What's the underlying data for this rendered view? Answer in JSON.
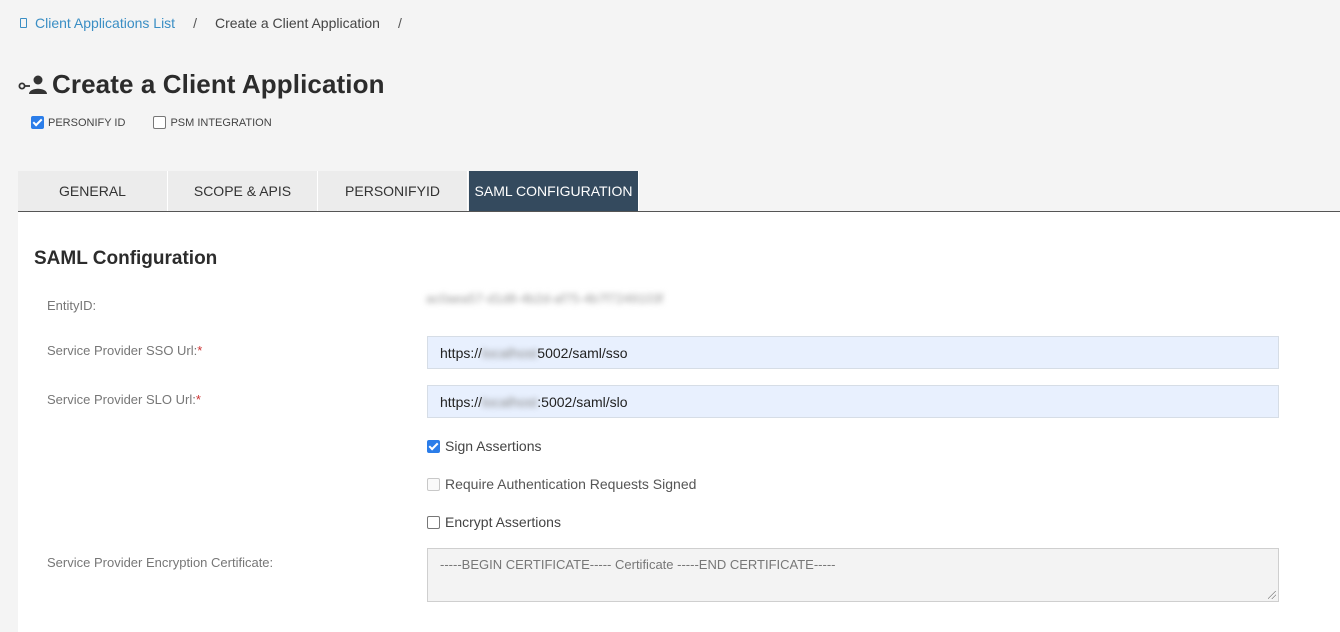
{
  "breadcrumb": {
    "items": [
      "Client Applications List",
      "Create a Client Application"
    ],
    "separator": "/"
  },
  "page": {
    "title": "Create a Client Application",
    "title_icon": "user-key-icon"
  },
  "app_types": [
    {
      "label": "PERSONIFY ID",
      "checked": true
    },
    {
      "label": "PSM INTEGRATION",
      "checked": false
    }
  ],
  "tabs": [
    {
      "label": "GENERAL",
      "active": false
    },
    {
      "label": "SCOPE & APIS",
      "active": false
    },
    {
      "label": "PERSONIFYID",
      "active": false
    },
    {
      "label": "SAML CONFIGURATION",
      "active": true
    }
  ],
  "saml": {
    "section_title": "SAML Configuration",
    "entity_label": "EntityID:",
    "entity_value": "ac0aea57-d1d8-4b2d-af75-4b7f7249103f",
    "sso_label": "Service Provider SSO Url:",
    "sso_prefix": "https://",
    "sso_host": "localhost",
    "sso_suffix": "5002/saml/sso",
    "slo_label": "Service Provider SLO Url:",
    "slo_prefix": "https://",
    "slo_host": "localhost",
    "slo_suffix": ":5002/saml/slo",
    "required_mark": "*",
    "sign_assertions": {
      "label": "Sign Assertions",
      "checked": true
    },
    "require_auth_signed": {
      "label": "Require Authentication Requests Signed",
      "checked": false,
      "disabled": true
    },
    "encrypt_assertions": {
      "label": "Encrypt Assertions",
      "checked": false
    },
    "cert_label": "Service Provider Encryption Certificate:",
    "cert_placeholder": "-----BEGIN CERTIFICATE----- Certificate -----END CERTIFICATE-----"
  },
  "colors": {
    "active_tab": "#344a5e",
    "link": "#3a8ec4",
    "checkbox": "#2b7de9",
    "input_bg": "#e8f0fe"
  }
}
